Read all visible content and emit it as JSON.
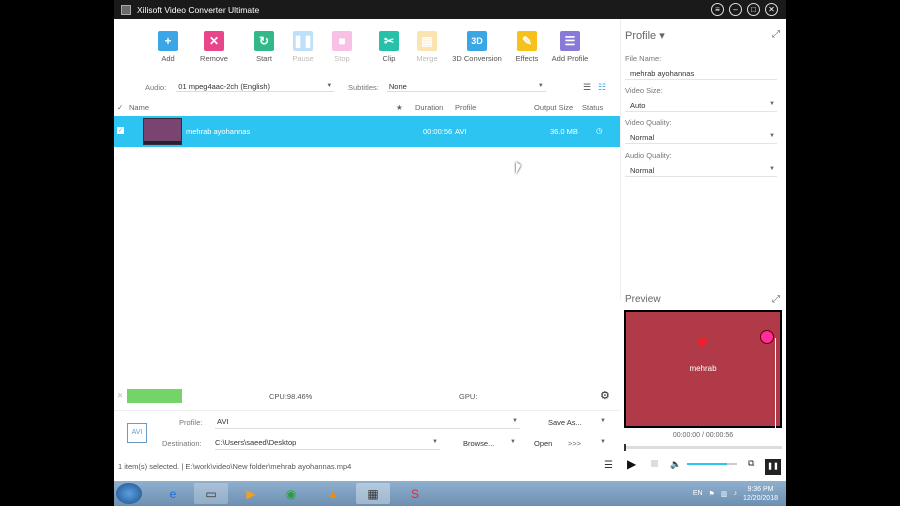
{
  "window": {
    "title": "Xilisoft Video Converter Ultimate"
  },
  "toolbar": [
    {
      "label": "Add",
      "icon": "plus-icon",
      "color": "#3aa6e6"
    },
    {
      "label": "Remove",
      "icon": "remove-icon",
      "color": "#e8468a"
    },
    {
      "label": "Start",
      "icon": "start-icon",
      "color": "#33b889"
    },
    {
      "label": "Pause",
      "icon": "pause-icon",
      "color": "#4aa8f0"
    },
    {
      "label": "Stop",
      "icon": "stop-icon",
      "color": "#e94cb4"
    },
    {
      "label": "Clip",
      "icon": "clip-icon",
      "color": "#27c0a8"
    },
    {
      "label": "Merge",
      "icon": "merge-icon",
      "color": "#f6b41c"
    },
    {
      "label": "3D Conversion",
      "icon": "3d-icon",
      "color": "#3aa6e6",
      "text": "3D"
    },
    {
      "label": "Effects",
      "icon": "effects-icon",
      "color": "#f5c11a"
    },
    {
      "label": "Add Profile",
      "icon": "add-profile-icon",
      "color": "#8a7ad8"
    }
  ],
  "options": {
    "audio_label": "Audio:",
    "audio_value": "01 mpeg4aac-2ch (English)",
    "subtitles_label": "Subtitles:",
    "subtitles_value": "None"
  },
  "columns": {
    "name": "Name",
    "duration": "Duration",
    "profile": "Profile",
    "output_size": "Output Size",
    "status": "Status"
  },
  "files": [
    {
      "name": "mehrab ayohannas",
      "duration": "00:00:56",
      "profile": "AVI",
      "output_size": "36.0 MB"
    }
  ],
  "status_area": {
    "cpu": "CPU:98.46%",
    "gpu": "GPU:"
  },
  "bottom": {
    "profile_label": "Profile:",
    "profile_value": "AVI",
    "save_as": "Save As...",
    "destination_label": "Destination:",
    "destination_value": "C:\\Users\\saeed\\Desktop",
    "browse": "Browse...",
    "open": "Open"
  },
  "statusbar": {
    "text": "1 item(s) selected. | E:\\work\\video\\New folder\\mehrab ayohannas.mp4"
  },
  "profile_panel": {
    "title": "Profile",
    "file_name_label": "File Name:",
    "file_name": "mehrab ayohannas",
    "video_size_label": "Video Size:",
    "video_size": "Auto",
    "video_quality_label": "Video Quality:",
    "video_quality": "Normal",
    "audio_quality_label": "Audio Quality:",
    "audio_quality": "Normal"
  },
  "preview": {
    "title": "Preview",
    "video_text": "mehrab",
    "time": "00:00:00 / 00:00:56",
    "volume": 0.8
  },
  "taskbar": {
    "lang": "EN",
    "time": "9:36 PM",
    "date": "12/20/2018"
  }
}
